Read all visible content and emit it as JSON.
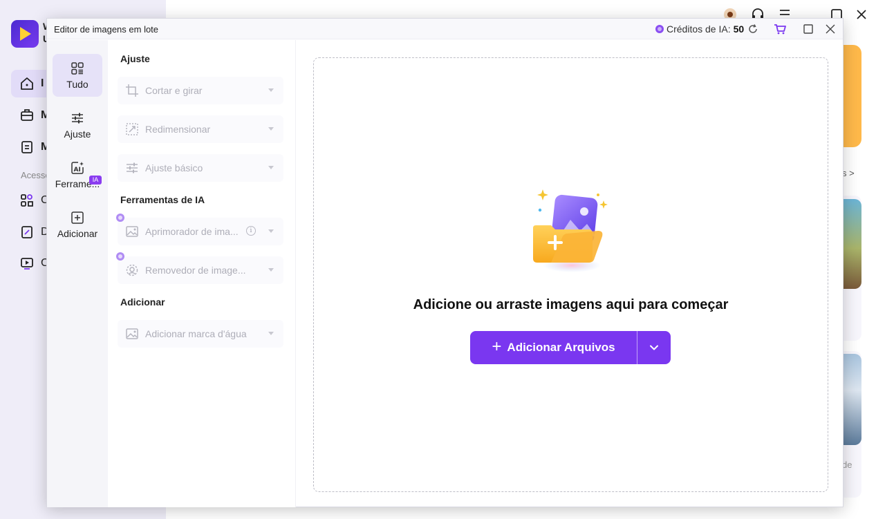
{
  "background_app": {
    "app_name_line1": "W",
    "app_name_line2": "U",
    "nav_letters": [
      "I",
      "M",
      "M"
    ],
    "section_label": "Acesso",
    "nav_letters_2": [
      "C",
      "D",
      "C"
    ],
    "side_text_1": "s >",
    "side_text_2": "de"
  },
  "modal": {
    "title": "Editor de imagens em lote",
    "credits_label": "Créditos de IA:",
    "credits_value": "50"
  },
  "rail": {
    "items": [
      {
        "label": "Tudo",
        "icon": "grid-icon",
        "active": true
      },
      {
        "label": "Ajuste",
        "icon": "sliders-icon",
        "active": false
      },
      {
        "label": "Ferrame...",
        "icon": "ai-tools-icon",
        "active": false,
        "badge": "IA"
      },
      {
        "label": "Adicionar",
        "icon": "add-square-icon",
        "active": false
      }
    ]
  },
  "options": {
    "sections": [
      {
        "title": "Ajuste",
        "items": [
          {
            "label": "Cortar e girar",
            "icon": "crop-rotate-icon"
          },
          {
            "label": "Redimensionar",
            "icon": "resize-icon"
          },
          {
            "label": "Ajuste básico",
            "icon": "sliders-icon"
          }
        ]
      },
      {
        "title": "Ferramentas de IA",
        "items": [
          {
            "label": "Aprimorador de ima...",
            "icon": "image-enhance-icon",
            "info": "i"
          },
          {
            "label": "Removedor de image...",
            "icon": "remove-bg-icon"
          }
        ]
      },
      {
        "title": "Adicionar",
        "items": [
          {
            "label": "Adicionar marca d'água",
            "icon": "watermark-icon"
          }
        ]
      }
    ]
  },
  "dropzone": {
    "message": "Adicione ou arraste imagens aqui para começar",
    "add_button_label": "Adicionar Arquivos",
    "add_button_icon": "plus-icon",
    "dropdown_icon": "chevron-down-icon"
  },
  "colors": {
    "accent": "#7a37f0",
    "rail_active": "#e6e2f8",
    "badge": "#8a3cf0"
  }
}
